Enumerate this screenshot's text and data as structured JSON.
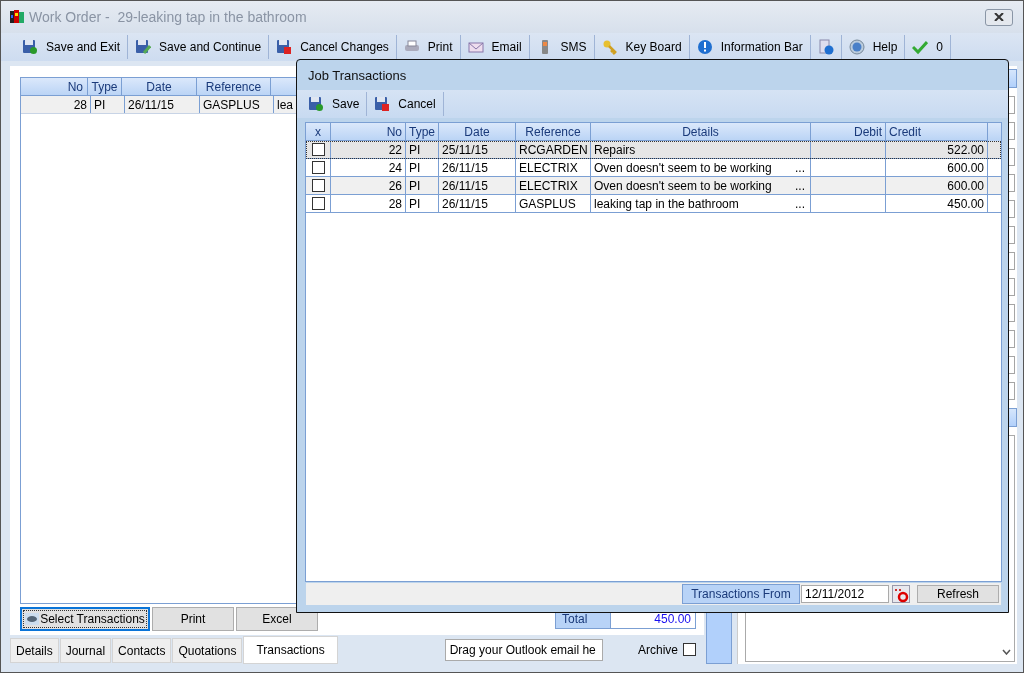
{
  "window": {
    "title": "Work Order -  29-leaking tap in the bathroom"
  },
  "toolbar": [
    {
      "kind": "savecheck",
      "label": "Save and Exit"
    },
    {
      "kind": "savepencil",
      "label": "Save and Continue"
    },
    {
      "kind": "savecross",
      "label": "Cancel Changes"
    },
    {
      "kind": "printer",
      "label": "Print"
    },
    {
      "kind": "envelope",
      "label": "Email"
    },
    {
      "kind": "phone",
      "label": "SMS"
    },
    {
      "kind": "key",
      "label": "Key Board"
    },
    {
      "kind": "info",
      "label": "Information Bar"
    },
    {
      "kind": "docinfo"
    },
    {
      "kind": "help",
      "label": "Help"
    },
    {
      "kind": "check",
      "label": "0"
    }
  ],
  "transactions_table": {
    "columns": [
      "No",
      "Type",
      "Date",
      "Reference"
    ],
    "rows": [
      {
        "cells": [
          "28",
          "PI",
          "26/11/15",
          "GASPLUS",
          "lea"
        ]
      }
    ]
  },
  "buttons": [
    {
      "label": "Select Transactions",
      "focused": true
    },
    {
      "label": "Print",
      "focused": false
    },
    {
      "label": "Excel",
      "focused": false
    }
  ],
  "total": {
    "label": "Total",
    "value": "450.00"
  },
  "tabs": [
    {
      "label": "Details",
      "selected": false
    },
    {
      "label": "Journal",
      "selected": false
    },
    {
      "label": "Contacts",
      "selected": false
    },
    {
      "label": "Quotations",
      "selected": false
    },
    {
      "label": "Transactions",
      "selected": true
    }
  ],
  "outlook_field": {
    "value": "Drag your Outlook email he"
  },
  "archive": {
    "label": "Archive",
    "checked": false
  },
  "dialog": {
    "title": "Job Transactions",
    "toolbar": [
      {
        "kind": "savecheck",
        "label": "Save"
      },
      {
        "kind": "savecross",
        "label": "Cancel"
      }
    ],
    "columns": [
      "x",
      "No",
      "Type",
      "Date",
      "Reference",
      "Details",
      "Debit",
      "Credit"
    ],
    "rows": [
      {
        "checked": false,
        "selected": true,
        "no": "22",
        "type": "PI",
        "date": "25/11/15",
        "reference": "RCGARDEN",
        "details": "Repairs",
        "credit": "522.00"
      },
      {
        "checked": false,
        "selected": false,
        "no": "24",
        "type": "PI",
        "date": "26/11/15",
        "reference": "ELECTRIX",
        "details": "Oven doesn't seem to be working",
        "more": "...",
        "credit": "600.00"
      },
      {
        "checked": false,
        "selected": false,
        "no": "26",
        "type": "PI",
        "date": "26/11/15",
        "reference": "ELECTRIX",
        "details": "Oven doesn't seem to be working",
        "more": "...",
        "credit": "600.00"
      },
      {
        "checked": false,
        "selected": false,
        "no": "28",
        "type": "PI",
        "date": "26/11/15",
        "reference": "GASPLUS",
        "details": "leaking tap in the bathroom",
        "more": "...",
        "credit": "450.00"
      }
    ],
    "from_label": "Transactions From",
    "from_date": "12/11/2012",
    "refresh": "Refresh"
  }
}
